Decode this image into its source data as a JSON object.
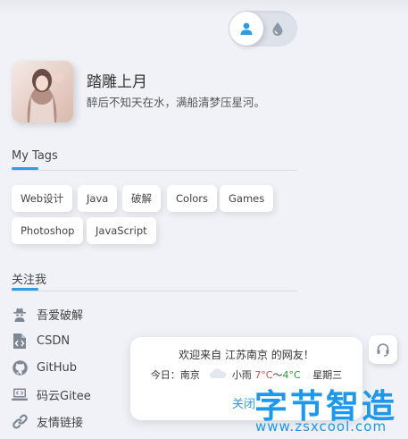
{
  "theme_toggle": {
    "icons": [
      "user-icon",
      "drop-icon"
    ],
    "accent": "#2c9ce8"
  },
  "profile": {
    "name": "踏雕上月",
    "bio": "醉后不知天在水，满船清梦压星河。"
  },
  "tags": {
    "title": "My Tags",
    "items": [
      "Web设计",
      "Java",
      "破解",
      "Colors",
      "Games",
      "Photoshop",
      "JavaScript"
    ]
  },
  "follow": {
    "title": "关注我",
    "links": [
      {
        "label": "吾爱破解",
        "icon": "spy-icon"
      },
      {
        "label": "CSDN",
        "icon": "code-file-icon"
      },
      {
        "label": "GitHub",
        "icon": "github-icon"
      },
      {
        "label": "码云Gitee",
        "icon": "laptop-code-icon"
      },
      {
        "label": "友情链接",
        "icon": "link-icon"
      }
    ]
  },
  "welcome": {
    "line1": "欢迎来自 江苏南京 的网友！",
    "today": "今日：南京",
    "weather": "小雨",
    "high": "7°C",
    "range_sep": "～",
    "low": "4°C",
    "weekday": "星期三",
    "close": "关闭"
  },
  "watermark": {
    "main": "字节智造",
    "sub": "www.zsxcool.com"
  }
}
